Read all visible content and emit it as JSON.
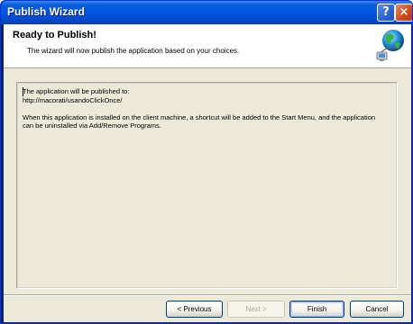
{
  "window": {
    "title": "Publish Wizard",
    "help_glyph": "?",
    "close_glyph": "×"
  },
  "header": {
    "title": "Ready to Publish!",
    "subtitle": "The wizard will now publish the application based on your choices.",
    "icon": "globe-network-icon"
  },
  "panel": {
    "text": "The application will be published to:\nhttp://macorati/usandoClickOnce/\n\nWhen this application is installed on the client machine, a shortcut will be added to the Start Menu, and the application can be uninstalled via Add/Remove Programs."
  },
  "buttons": {
    "previous": "< Previous",
    "next": "Next >",
    "finish": "Finish",
    "cancel": "Cancel"
  },
  "colors": {
    "titlebar": "#0055e5",
    "client_bg": "#ece9d8"
  }
}
